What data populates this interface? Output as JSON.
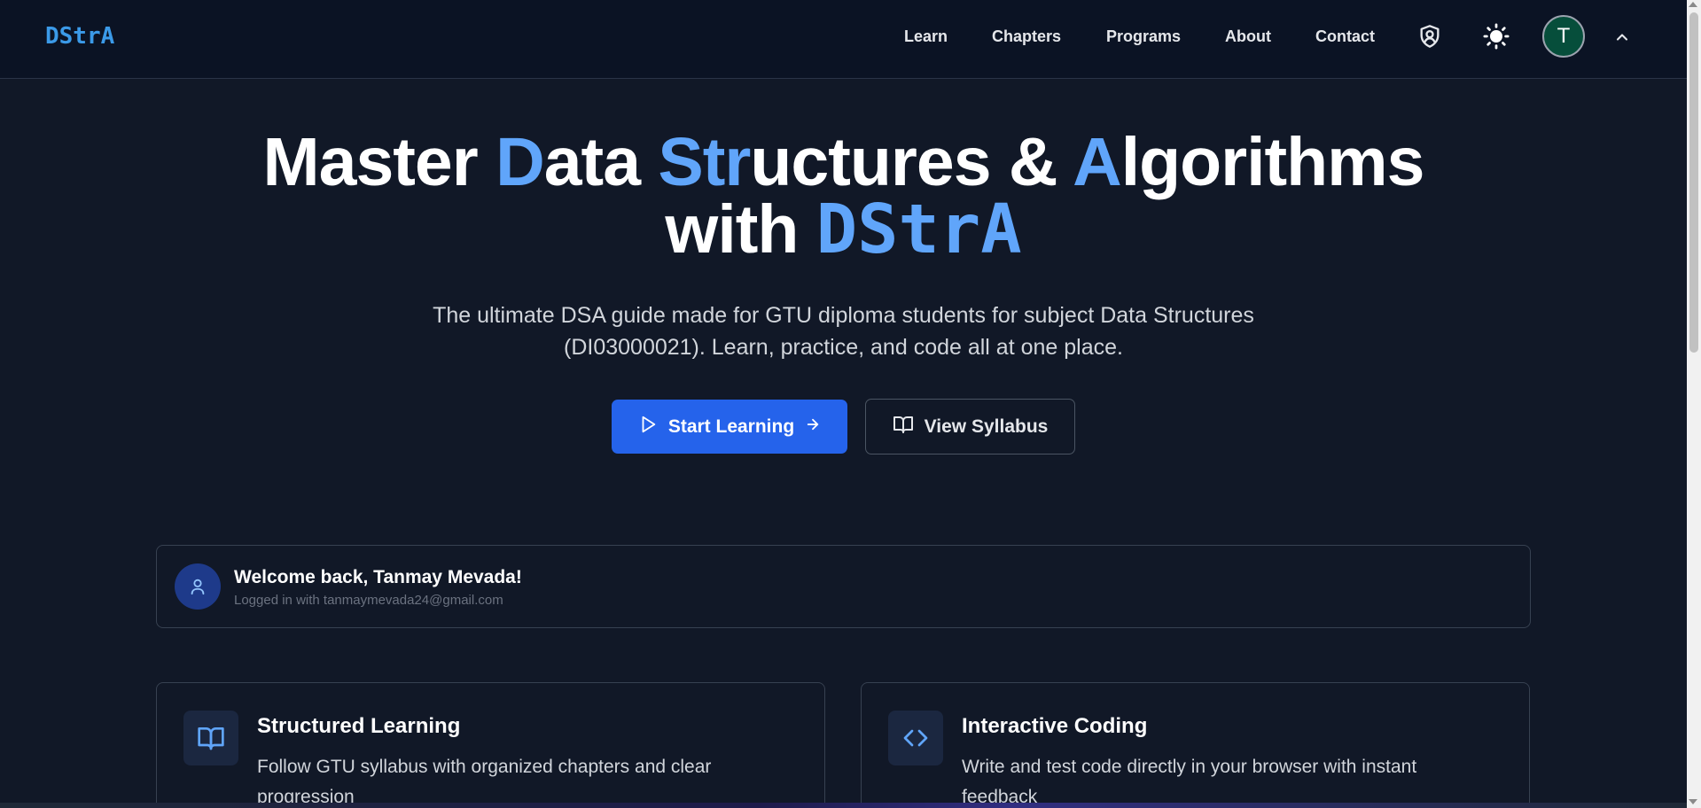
{
  "header": {
    "logo": "DStrA",
    "nav": [
      "Learn",
      "Chapters",
      "Programs",
      "About",
      "Contact"
    ],
    "icons": [
      "shield-user-icon",
      "sun-icon",
      "chevron-up-icon"
    ],
    "avatar_initial": "T"
  },
  "hero": {
    "title_parts": [
      "Master ",
      "D",
      "ata ",
      "Str",
      "uctures & ",
      "A",
      "lgorithms"
    ],
    "title_line2_prefix": "with ",
    "title_line2_brand": "DStrA",
    "subtitle": "The ultimate DSA guide made for GTU diploma students for subject Data Structures (DI03000021). Learn, practice, and code all at one place.",
    "primary_button": "Start Learning",
    "secondary_button": "View Syllabus"
  },
  "welcome": {
    "title": "Welcome back, Tanmay Mevada!",
    "meta": "Logged in with tanmaymevada24@gmail.com"
  },
  "features": [
    {
      "icon": "book-open-icon",
      "title": "Structured Learning",
      "desc": "Follow GTU syllabus with organized chapters and clear progression"
    },
    {
      "icon": "code-icon",
      "title": "Interactive Coding",
      "desc": "Write and test code directly in your browser with instant feedback"
    }
  ],
  "colors": {
    "background": "#111827",
    "accent": "#60a5fa",
    "primary": "#2563eb",
    "logo": "#3b9ae8",
    "avatar": "#064e3b"
  }
}
